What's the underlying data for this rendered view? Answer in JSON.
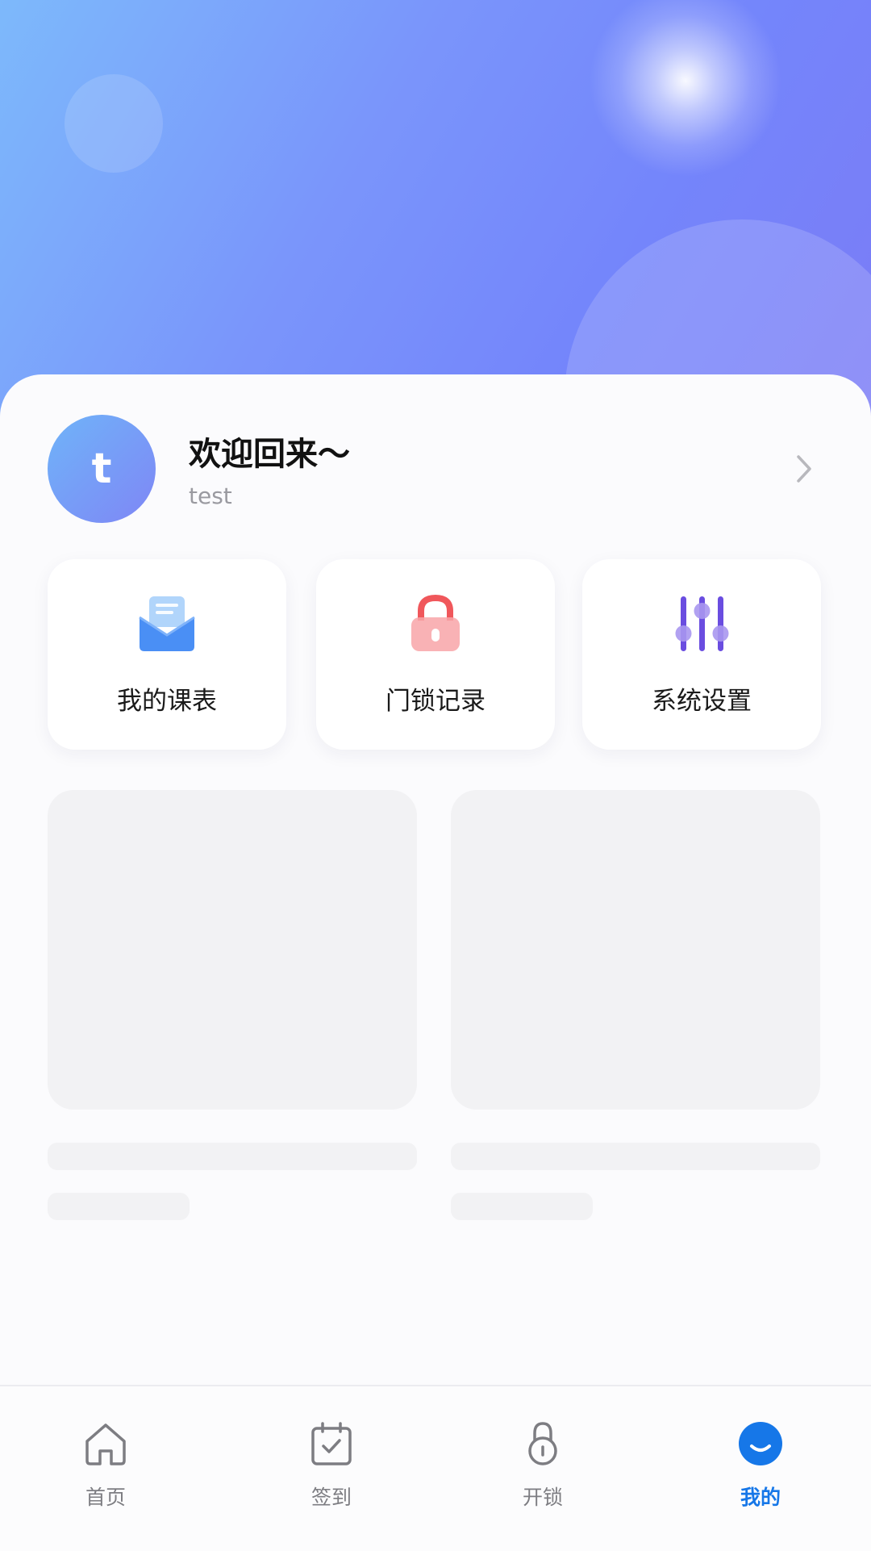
{
  "profile": {
    "avatar_initial": "t",
    "welcome": "欢迎回来～",
    "username": "test"
  },
  "quick_actions": [
    {
      "label": "我的课表",
      "icon": "mail-envelope-icon",
      "color": "#4a8ff5"
    },
    {
      "label": "门锁记录",
      "icon": "padlock-icon",
      "color": "#f0575b"
    },
    {
      "label": "系统设置",
      "icon": "sliders-icon",
      "color": "#6a4de0"
    }
  ],
  "tabbar": {
    "items": [
      {
        "label": "首页",
        "icon": "home-icon",
        "active": false
      },
      {
        "label": "签到",
        "icon": "calendar-check-icon",
        "active": false
      },
      {
        "label": "开锁",
        "icon": "lock-icon",
        "active": false
      },
      {
        "label": "我的",
        "icon": "smile-icon",
        "active": true
      }
    ],
    "active_color": "#1677e8",
    "inactive_color": "#7d7d82"
  },
  "colors": {
    "hero_start": "#7db9fb",
    "hero_end": "#7b7cf6",
    "skeleton": "#f2f2f4"
  }
}
